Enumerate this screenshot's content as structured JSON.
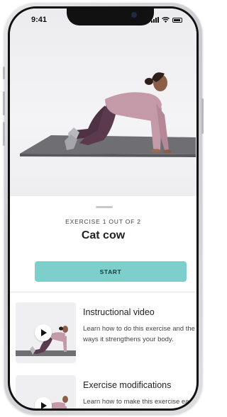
{
  "status_bar": {
    "time": "9:41"
  },
  "exercise": {
    "counter": "EXERCISE  1 OUT OF 2",
    "title": "Cat cow",
    "start_label": "START"
  },
  "cards": [
    {
      "title": "Instructional video",
      "description": "Learn how to do this exercise and the ways it strengthens your body."
    },
    {
      "title": "Exercise modifications",
      "description": "Learn how to make this exercise easier or more challenging"
    }
  ],
  "colors": {
    "accent": "#7ccfcb",
    "text": "#222222"
  }
}
